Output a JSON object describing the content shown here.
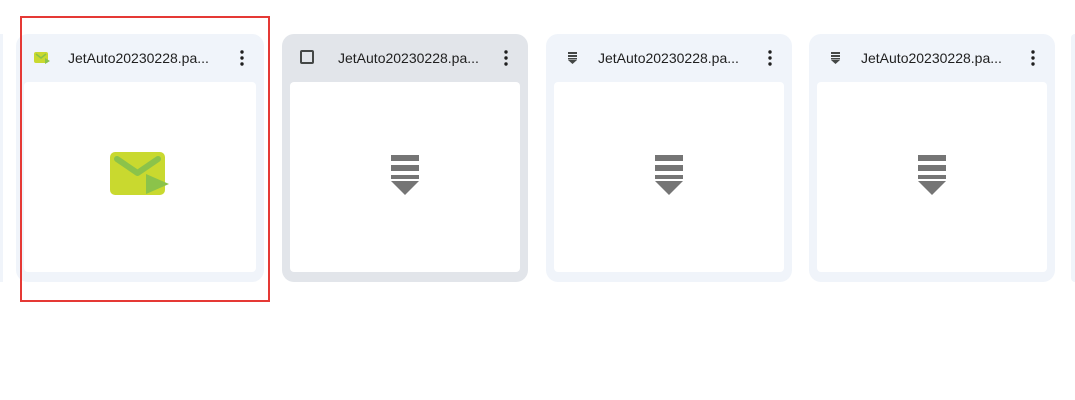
{
  "files": [
    {
      "name": "JetAuto20230228.pa...",
      "icon": "email-file-icon",
      "state": "selected-outlined"
    },
    {
      "name": "JetAuto20230228.pa...",
      "icon": "download-file-icon",
      "state": "hover"
    },
    {
      "name": "JetAuto20230228.pa...",
      "icon": "download-file-icon",
      "state": "default"
    },
    {
      "name": "JetAuto20230228.pa...",
      "icon": "download-file-icon",
      "state": "default"
    }
  ],
  "colors": {
    "card_bg": "#f0f4fa",
    "card_hover_bg": "#e2e5ea",
    "email_icon": "#c9d92f",
    "email_icon_accent": "#8bc34a",
    "download_icon": "#757575",
    "highlight": "#e53935"
  }
}
